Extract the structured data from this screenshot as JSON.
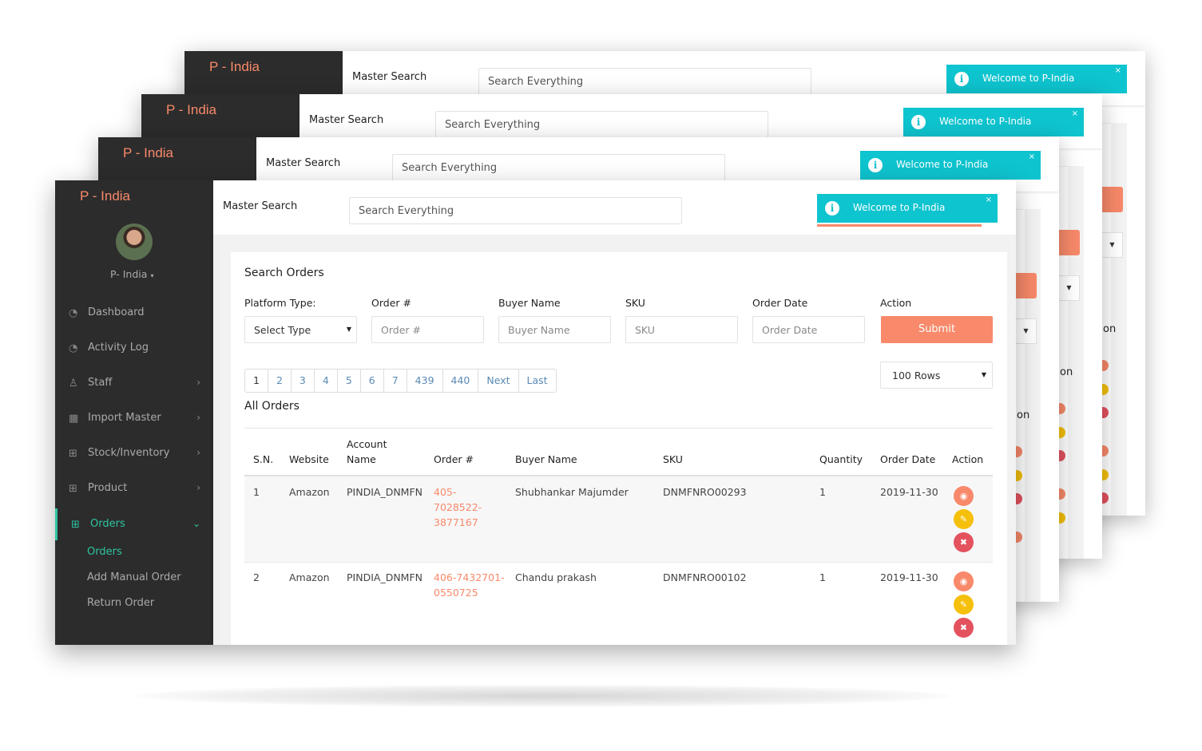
{
  "app": {
    "brand": "P - India"
  },
  "header": {
    "master_search_label": "Master Search",
    "search_placeholder": "Search Everything",
    "toast": {
      "icon": "info-icon",
      "text": "Welcome to P-India",
      "close": "×"
    }
  },
  "user": {
    "name": "P- India",
    "caret": "▾"
  },
  "sidebar": {
    "items": [
      {
        "label": "Dashboard",
        "icon": "dashboard-icon",
        "glyph": "◔"
      },
      {
        "label": "Activity Log",
        "icon": "activity-icon",
        "glyph": "◔"
      },
      {
        "label": "Staff",
        "icon": "user-icon",
        "glyph": "♙",
        "arrow": "›"
      },
      {
        "label": "Import Master",
        "icon": "gift-icon",
        "glyph": "▦",
        "arrow": "›"
      },
      {
        "label": "Stock/Inventory",
        "icon": "cart-icon",
        "glyph": "⊞",
        "arrow": "›"
      },
      {
        "label": "Product",
        "icon": "cart-icon",
        "glyph": "⊞",
        "arrow": "›"
      },
      {
        "label": "Orders",
        "icon": "cart-icon",
        "glyph": "⊞",
        "arrow": "⌄"
      }
    ],
    "submenu": [
      "Orders",
      "Add Manual Order",
      "Return Order"
    ]
  },
  "search_orders": {
    "title": "Search Orders",
    "fields": {
      "platform_label": "Platform Type:",
      "platform_value": "Select Type",
      "order_label": "Order #",
      "order_placeholder": "Order #",
      "buyer_label": "Buyer Name",
      "buyer_placeholder": "Buyer Name",
      "sku_label": "SKU",
      "sku_placeholder": "SKU",
      "date_label": "Order Date",
      "date_placeholder": "Order Date",
      "action_label": "Action"
    },
    "submit": "Submit",
    "caret": "▼"
  },
  "pagination": {
    "pages": [
      "1",
      "2",
      "3",
      "4",
      "5",
      "6",
      "7",
      "439",
      "440",
      "Next",
      "Last"
    ]
  },
  "rows_select": {
    "value": "100 Rows"
  },
  "orders_table": {
    "title": "All Orders",
    "headers": {
      "sn": "S.N.",
      "website": "Website",
      "account_1": "Account",
      "account_2": "Name",
      "order": "Order #",
      "buyer": "Buyer Name",
      "sku": "SKU",
      "quantity": "Quantity",
      "date": "Order Date",
      "action": "Action"
    },
    "rows": [
      {
        "sn": "1",
        "website": "Amazon",
        "account": "PINDIA_DNMFN",
        "order_lines": [
          "405-",
          "7028522-",
          "3877167"
        ],
        "buyer": "Shubhankar Majumder",
        "sku": "DNMFNRO00293",
        "quantity": "1",
        "date": "2019-11-30"
      },
      {
        "sn": "2",
        "website": "Amazon",
        "account": "PINDIA_DNMFN",
        "order_lines": [
          "406-7432701-",
          "0550725"
        ],
        "buyer": "Chandu prakash",
        "sku": "DNMFNRO00102",
        "quantity": "1",
        "date": "2019-11-30"
      }
    ],
    "action_icons": [
      "eye-icon",
      "pencil-icon",
      "close-icon"
    ],
    "action_glyphs": [
      "◉",
      "✎",
      "✖"
    ]
  },
  "ghost_text": {
    "action_suffix": "on"
  },
  "colors": {
    "accent": "#f8896a",
    "teal": "#0ec4cf",
    "sidebar": "#2c2c2c",
    "active": "#2ec4a0",
    "warning": "#f5c00b",
    "danger": "#e4525e"
  }
}
